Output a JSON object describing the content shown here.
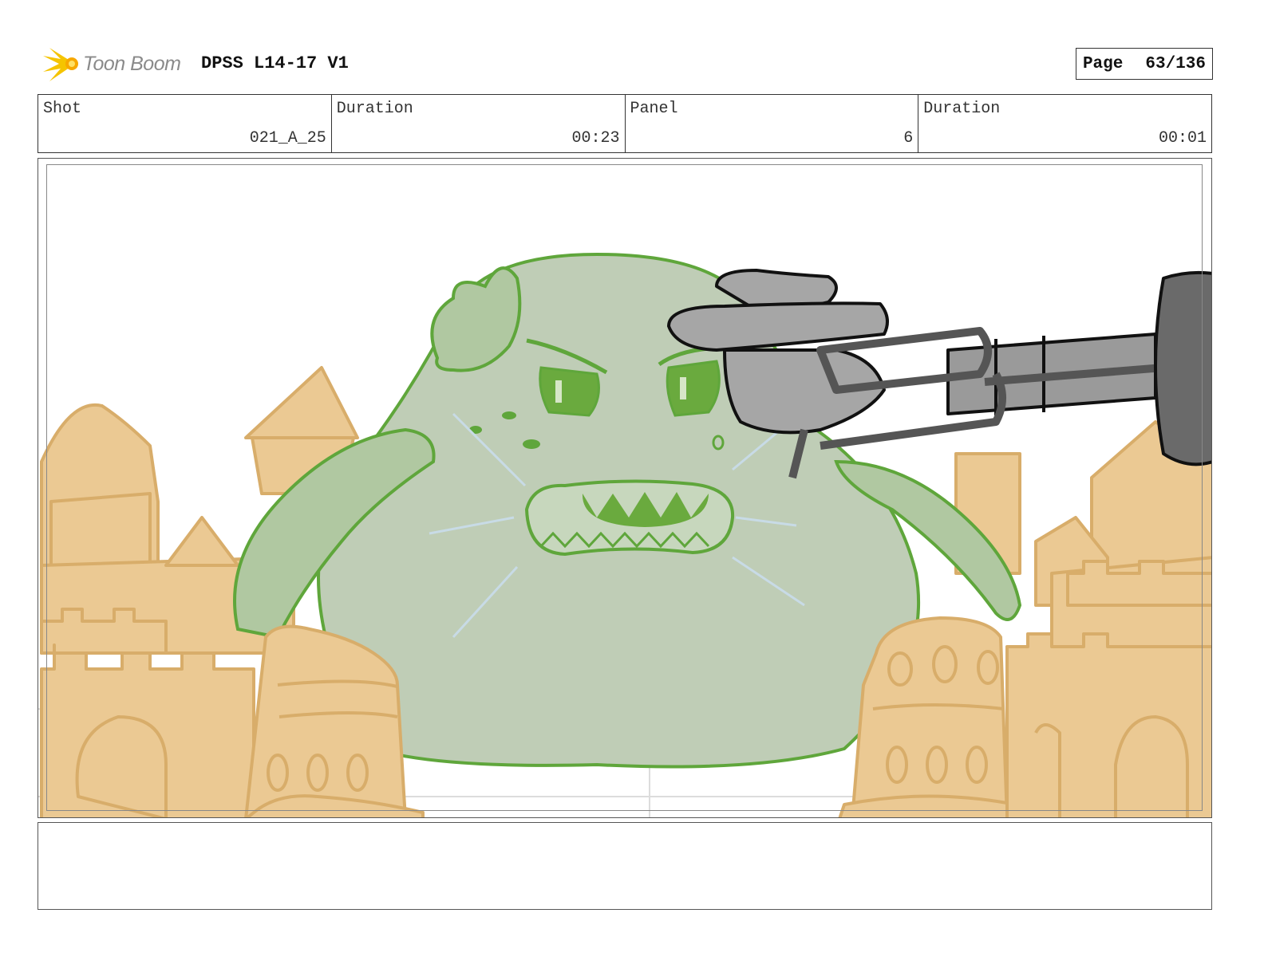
{
  "header": {
    "brand_name": "Toon Boom",
    "logo_icon": "starburst-logo-icon",
    "document_title": "DPSS L14-17 V1",
    "page_label": "Page",
    "page_value": "63/136"
  },
  "meta": [
    {
      "label": "Shot",
      "value": "021_A_25"
    },
    {
      "label": "Duration",
      "value": "00:23"
    },
    {
      "label": "Panel",
      "value": "6"
    },
    {
      "label": "Duration",
      "value": "00:01"
    }
  ],
  "panel": {
    "description_icons": [
      "slime-monster",
      "sand-castle",
      "robot-arm-hand"
    ],
    "colors": {
      "slime_fill": "#bfcdb6",
      "slime_line": "#5fa63b",
      "sand_fill": "#ebc993",
      "sand_line": "#d8ad6a",
      "robot_fill": "#a6a6a6",
      "robot_dark": "#5e5e5e"
    }
  },
  "notes": {
    "text": ""
  }
}
